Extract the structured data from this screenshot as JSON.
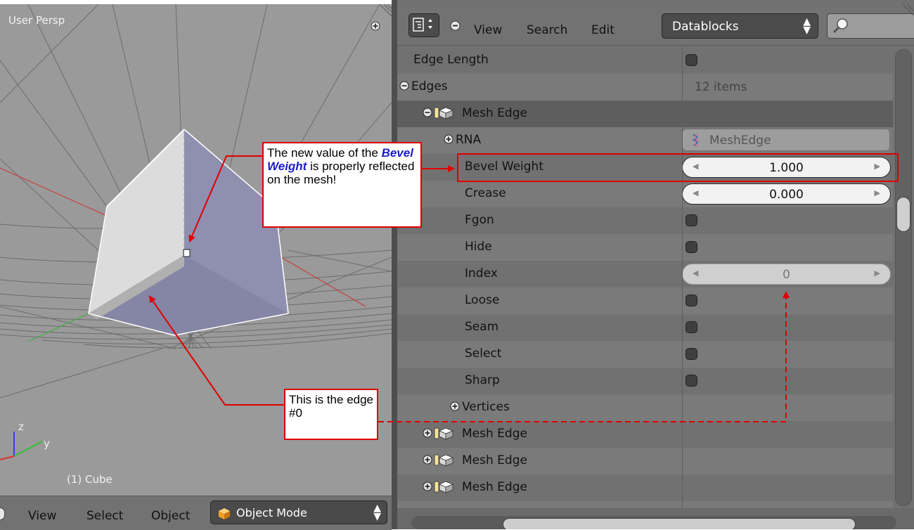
{
  "viewport": {
    "title": "User Persp",
    "object_label": "(1) Cube",
    "axis_labels": {
      "z": "z",
      "y": "y"
    },
    "menus": [
      "View",
      "Select",
      "Object"
    ],
    "mode": "Object Mode"
  },
  "outliner": {
    "header": {
      "menus": [
        "View",
        "Search",
        "Edit"
      ],
      "display_mode": "Datablocks"
    },
    "rows": {
      "edge_length": "Edge Length",
      "edges": "Edges",
      "edges_count": "12 items",
      "mesh_edge": "Mesh Edge",
      "rna": "RNA",
      "rna_value": "MeshEdge",
      "bevel_weight": "Bevel Weight",
      "bevel_weight_value": "1.000",
      "crease": "Crease",
      "crease_value": "0.000",
      "fgon": "Fgon",
      "hide": "Hide",
      "index": "Index",
      "index_value": "0",
      "loose": "Loose",
      "seam": "Seam",
      "select": "Select",
      "sharp": "Sharp",
      "vertices": "Vertices",
      "mesh_edge_2": "Mesh Edge",
      "mesh_edge_3": "Mesh Edge",
      "mesh_edge_4": "Mesh Edge"
    }
  },
  "annotations": {
    "callout1_part1": "The new value of the",
    "callout1_highlight": "Bevel Weight",
    "callout1_part2": "is properly reflected on the mesh!",
    "callout2": "This is the edge #0"
  },
  "colors": {
    "annotation_red": "#e00000",
    "highlight_blue": "#1c1cc8",
    "cube_light_face": "#d8d8d8",
    "cube_blue_face": "#8f8fb0"
  }
}
